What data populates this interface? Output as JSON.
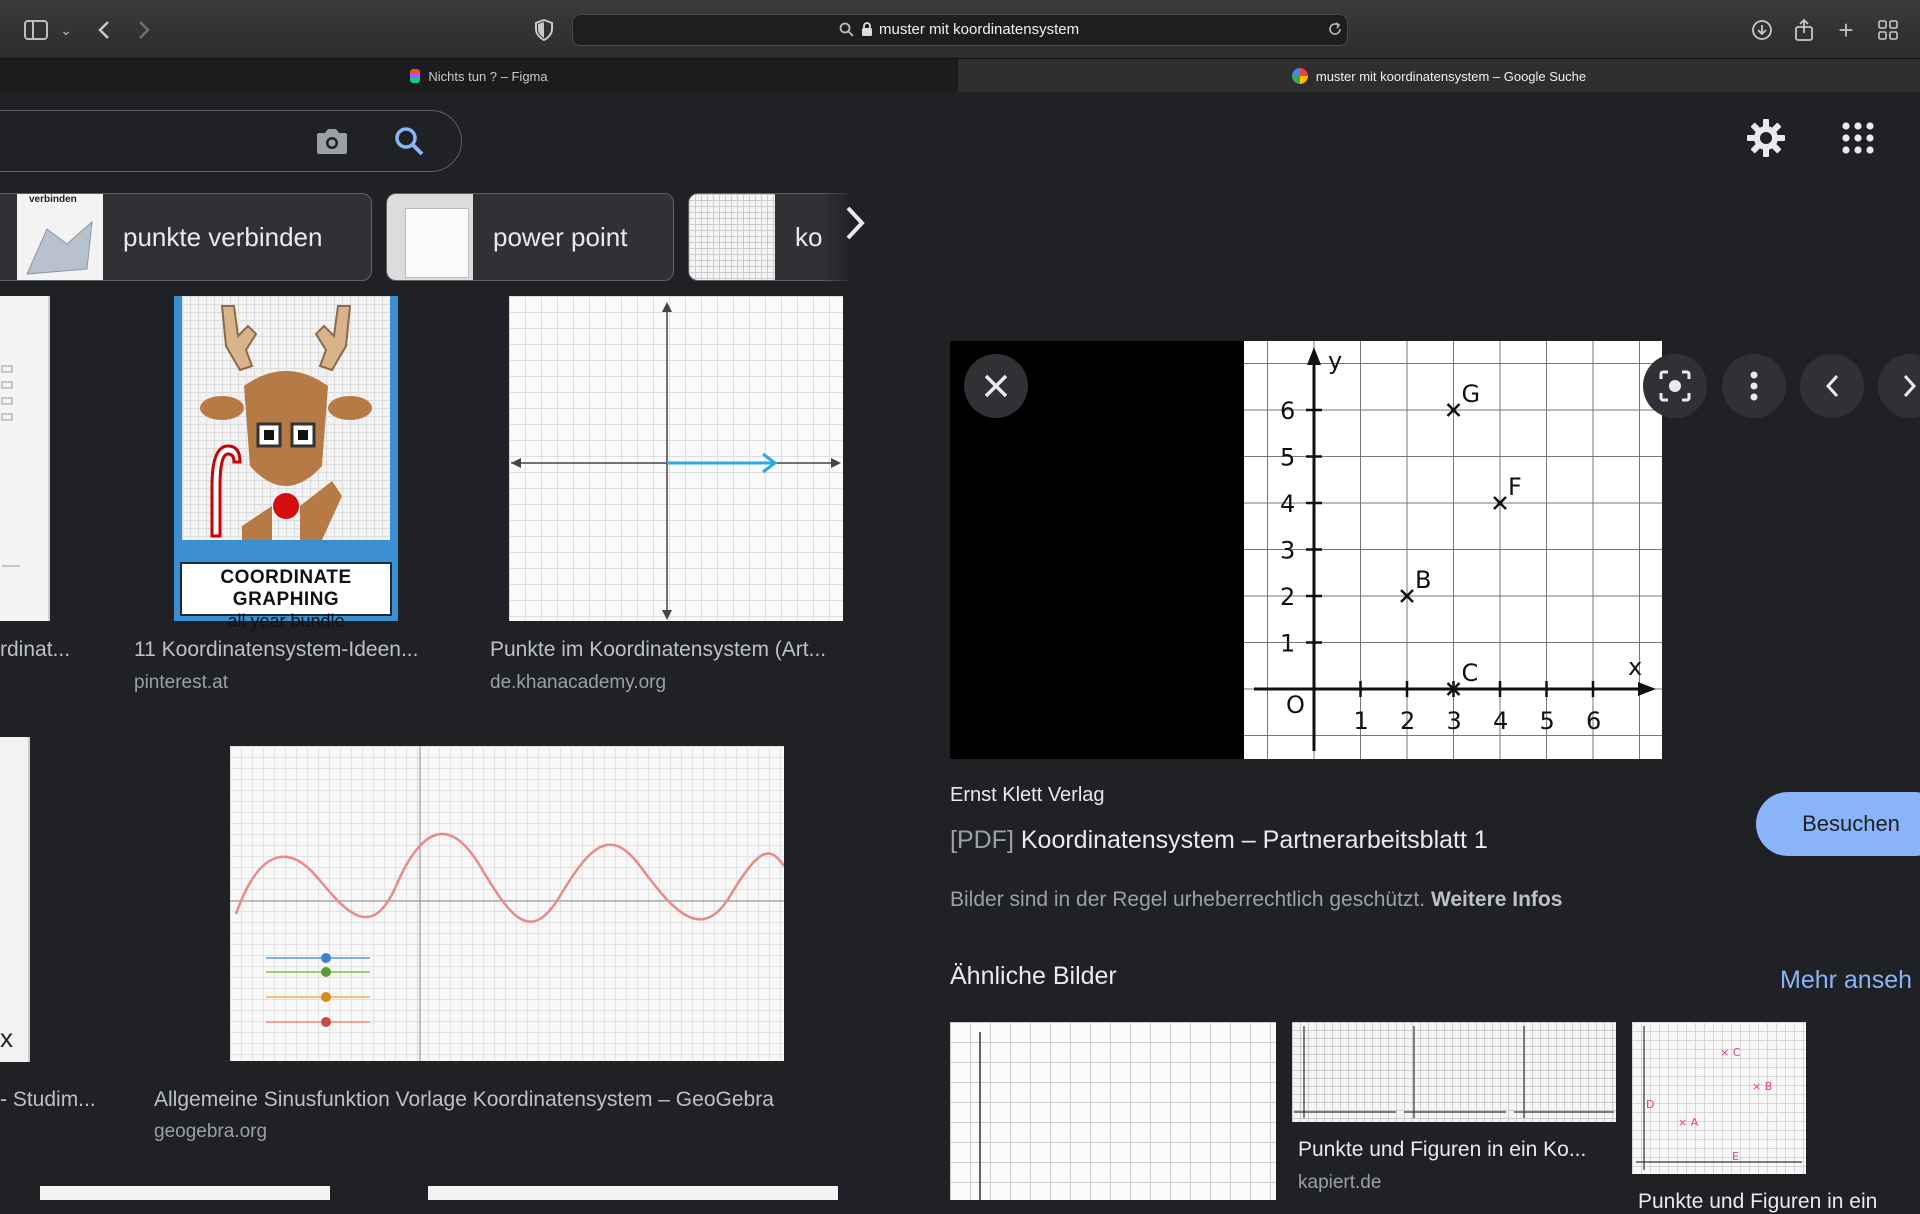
{
  "browser": {
    "url": "muster mit koordinatensystem",
    "tabs": [
      {
        "label": "Nichts tun ? – Figma"
      },
      {
        "label": "muster mit koordinatensystem – Google Suche"
      }
    ]
  },
  "chips": [
    {
      "label": "punkte verbinden"
    },
    {
      "label": "power point"
    },
    {
      "label": "ko"
    }
  ],
  "results": [
    {
      "title": "rdinat...",
      "source": ""
    },
    {
      "title": "11 Koordinatensystem-Ideen...",
      "source": "pinterest.at",
      "thumb_caption_line1": "COORDINATE GRAPHING",
      "thumb_caption_line2": "all year bundle"
    },
    {
      "title": "Punkte im Koordinatensystem (Art...",
      "source": "de.khanacademy.org"
    },
    {
      "title": "- Studim...",
      "source": ""
    },
    {
      "title": "Allgemeine Sinusfunktion Vorlage Koordinatensystem – GeoGebra",
      "source": "geogebra.org"
    }
  ],
  "thumb_texts": {
    "verbinden": "verbinden",
    "x_label": "x"
  },
  "panel": {
    "publisher": "Ernst Klett Verlag",
    "pdf_tag": "[PDF]",
    "title": "Koordinatensystem – Partnerarbeitsblatt 1",
    "copyright": "Bilder sind in der Regel urheberrechtlich geschützt.",
    "more_info": "Weitere Infos",
    "visit": "Besuchen",
    "similar_heading": "Ähnliche Bilder",
    "more_link": "Mehr anseh",
    "similar": [
      {
        "title": "",
        "source": ""
      },
      {
        "title": "Punkte und Figuren in ein Ko...",
        "source": "kapiert.de"
      },
      {
        "title": "Punkte und Figuren in ein",
        "source": ""
      }
    ]
  },
  "figure": {
    "axis_x_label": "x",
    "axis_y_label": "y",
    "origin_label": "O",
    "x_ticks": [
      "1",
      "2",
      "3",
      "4",
      "5",
      "6"
    ],
    "y_ticks": [
      "1",
      "2",
      "3",
      "4",
      "5",
      "6"
    ],
    "points": [
      {
        "label": "G",
        "x": 3,
        "y": 6
      },
      {
        "label": "F",
        "x": 4,
        "y": 4
      },
      {
        "label": "B",
        "x": 2,
        "y": 2
      },
      {
        "label": "C",
        "x": 3,
        "y": 0
      }
    ]
  }
}
